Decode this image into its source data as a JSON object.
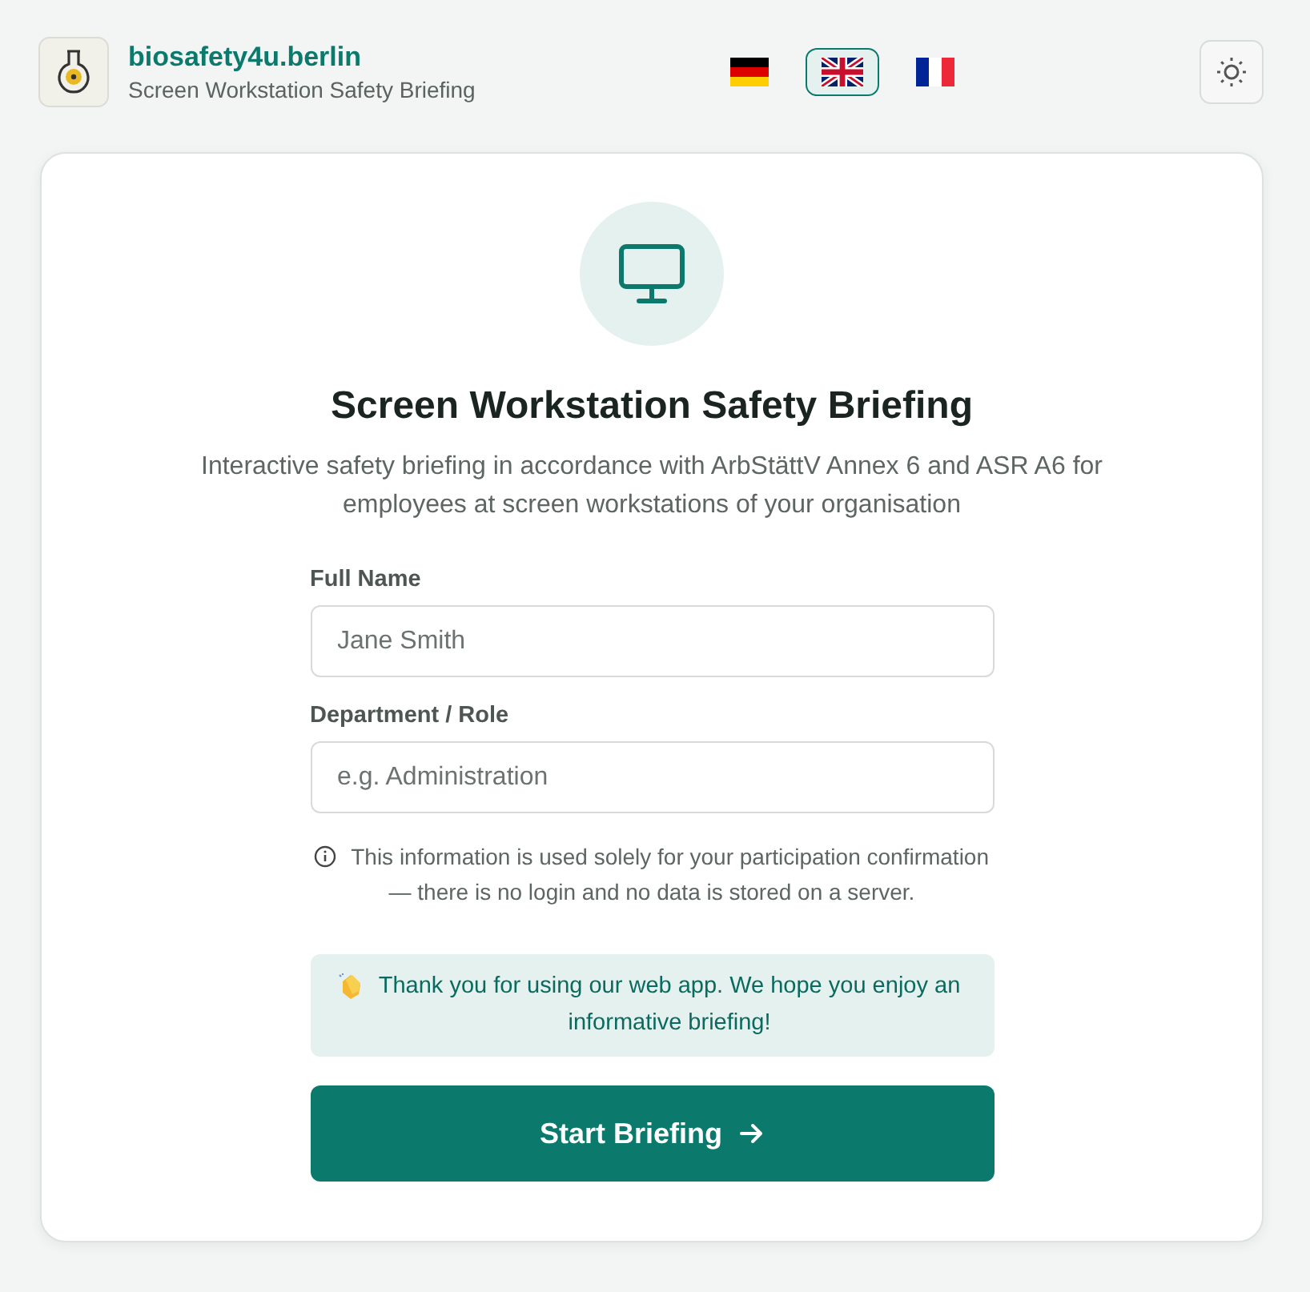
{
  "header": {
    "site": "biosafety4u.berlin",
    "subtitle": "Screen Workstation Safety Briefing"
  },
  "languages": [
    {
      "kind": "de",
      "selected": false
    },
    {
      "kind": "en",
      "selected": true
    },
    {
      "kind": "fr",
      "selected": false
    }
  ],
  "card": {
    "title": "Screen Workstation Safety Briefing",
    "description": "Interactive safety briefing in accordance with ArbStättV Annex 6 and ASR A6 for employees at screen workstations of your organisation",
    "fields": [
      {
        "label": "Full Name",
        "placeholder": "Jane Smith"
      },
      {
        "label": "Department / Role",
        "placeholder": "e.g. Administration"
      }
    ],
    "privacy_note": "This information is used solely for your participation confirmation — there is no login and no data is stored on a server.",
    "thanks": "Thank you for using our web app. We hope you enjoy an informative briefing!",
    "button": "Start Briefing"
  }
}
